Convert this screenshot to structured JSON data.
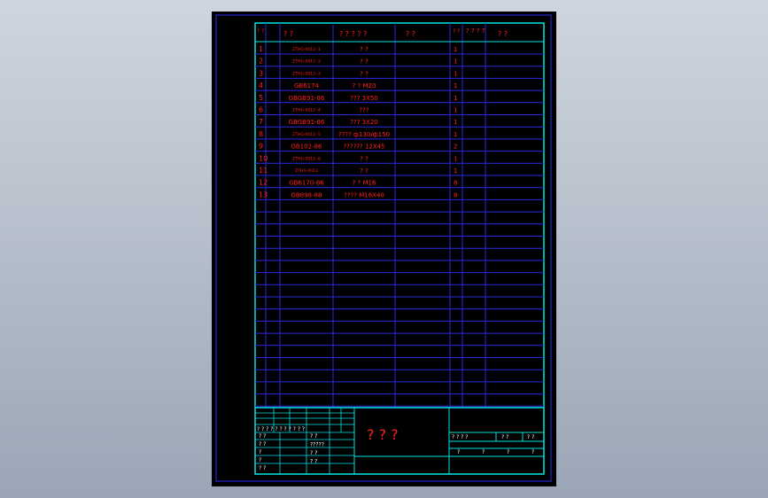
{
  "colors": {
    "sheet": "#000000",
    "frame_outer": "#2d2dff",
    "frame_inner": "#00e5e5",
    "grid": "#2a2ae0",
    "text_red": "#ff2020",
    "text_white": "#ffffff"
  },
  "header": {
    "col_no": "? ?",
    "col_code": "?   ?",
    "col_name": "? ? ? ? ?",
    "col_material": "?   ?",
    "col_qty": "? ?",
    "col_weight": "? ? ? ?",
    "col_remark": "?   ?"
  },
  "rows": [
    {
      "no": "1",
      "code": "ZTHG-0013 -1",
      "name": "?  ?",
      "qty": "1"
    },
    {
      "no": "2",
      "code": "ZTHG-0013 -2",
      "name": "?  ?",
      "qty": "1"
    },
    {
      "no": "3",
      "code": "ZTHG-0013 -3",
      "name": "?  ?",
      "qty": "1"
    },
    {
      "no": "4",
      "code": "GB6174",
      "name": "?  ? M20",
      "qty": "1"
    },
    {
      "no": "5",
      "code": "GBGB91-86",
      "name": "??? 3X50",
      "qty": "1"
    },
    {
      "no": "6",
      "code": "ZTHG-0013 -4",
      "name": "???",
      "qty": "1"
    },
    {
      "no": "7",
      "code": "GBGB91-86",
      "name": "??? 3X20",
      "qty": "1"
    },
    {
      "no": "8",
      "code": "ZTHG-0013 -5",
      "name": "???? ф130/ф150",
      "qty": "1"
    },
    {
      "no": "9",
      "code": "GB102-86",
      "name": "?????? 12X45",
      "qty": "2"
    },
    {
      "no": "10",
      "code": "ZTHG-0013 -6",
      "name": "?  ?",
      "qty": "1"
    },
    {
      "no": "11",
      "code": "ZTHG-0013",
      "name": "? ?",
      "qty": "1"
    },
    {
      "no": "12",
      "code": "GB6170-86",
      "name": "?  ? M16",
      "qty": "8"
    },
    {
      "no": "13",
      "code": "GB898-88",
      "name": "???? M16X40",
      "qty": "8"
    }
  ],
  "title_block": {
    "drawing_title": "?  ?  ?",
    "rev_header": "? ? ? ? ? ? ? ? ? ? ?",
    "sign_rows": [
      "? ?",
      "? ?",
      "?",
      "?",
      "? ?"
    ],
    "sign_mid": [
      "? ?",
      "?????",
      "? ?",
      "? ?"
    ],
    "right_row1": [
      "? ? ? ?",
      "? ?",
      "? ?"
    ],
    "right_row2": [
      "?",
      "?",
      "?",
      "?"
    ]
  }
}
